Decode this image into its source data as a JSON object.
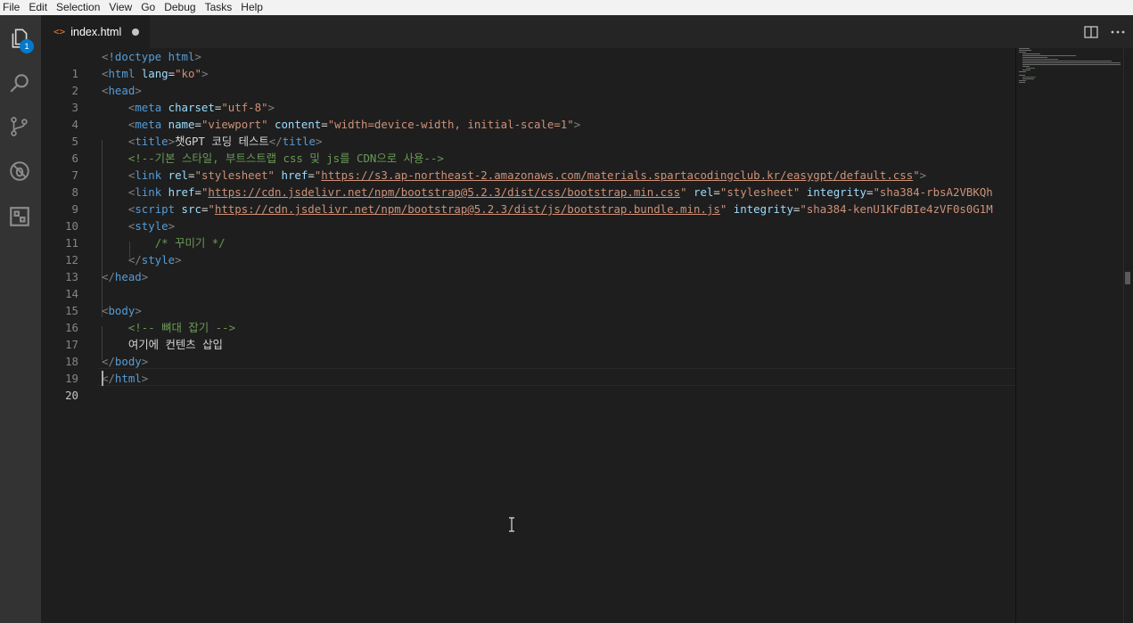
{
  "menu": [
    "File",
    "Edit",
    "Selection",
    "View",
    "Go",
    "Debug",
    "Tasks",
    "Help"
  ],
  "activity": {
    "explorer_badge": "1",
    "icons": [
      "files-icon",
      "search-icon",
      "source-control-icon",
      "debug-icon",
      "extensions-icon"
    ]
  },
  "tab": {
    "icon": "<>",
    "title": "index.html"
  },
  "editor": {
    "active_line": 20,
    "lines": [
      {
        "n": "1"
      },
      {
        "n": "2"
      },
      {
        "n": "3"
      },
      {
        "n": "4"
      },
      {
        "n": "5"
      },
      {
        "n": "6"
      },
      {
        "n": "7"
      },
      {
        "n": "8"
      },
      {
        "n": "9"
      },
      {
        "n": "10"
      },
      {
        "n": "11"
      },
      {
        "n": "12"
      },
      {
        "n": "13"
      },
      {
        "n": "14"
      },
      {
        "n": "15"
      },
      {
        "n": "16"
      },
      {
        "n": "17"
      },
      {
        "n": "18"
      },
      {
        "n": "19"
      },
      {
        "n": "20"
      }
    ],
    "code": {
      "l1_doctype": "!doctype html",
      "l2_attr": "lang",
      "l2_val": "\"ko\"",
      "l4_attr": "charset",
      "l4_val": "\"utf-8\"",
      "l5_attr1": "name",
      "l5_val1": "\"viewport\"",
      "l5_attr2": "content",
      "l5_val2": "\"width=device-width, initial-scale=1\"",
      "l6_title": "챗GPT 코딩 테스트",
      "l7_comment": "<!--기본 스타일, 부트스트랩 css 및 js를 CDN으로 사용-->",
      "l8_attr1": "rel",
      "l8_val1": "\"stylesheet\"",
      "l8_attr2": "href",
      "l8_url": "https://s3.ap-northeast-2.amazonaws.com/materials.spartacodingclub.kr/easygpt/default.css",
      "l9_attr1": "href",
      "l9_url": "https://cdn.jsdelivr.net/npm/bootstrap@5.2.3/dist/css/bootstrap.min.css",
      "l9_attr2": "rel",
      "l9_val2": "\"stylesheet\"",
      "l9_attr3": "integrity",
      "l9_val3": "\"sha384-rbsA2VBKQh",
      "l10_attr1": "src",
      "l10_url": "https://cdn.jsdelivr.net/npm/bootstrap@5.2.3/dist/js/bootstrap.bundle.min.js",
      "l10_attr2": "integrity",
      "l10_val2": "\"sha384-kenU1KFdBIe4zVF0s0G1M",
      "l12_comment": "/* 꾸미기 */",
      "l17_comment": "<!-- 뼈대 잡기 -->",
      "l18_text": "여기에 컨텐츠 삽입"
    },
    "tags": {
      "html": "html",
      "head": "head",
      "meta": "meta",
      "title": "title",
      "link": "link",
      "script": "script",
      "style": "style",
      "body": "body"
    }
  },
  "colors": {
    "keyword_tag": "#569cd6",
    "attribute": "#9cdcfe",
    "string": "#ce9178",
    "comment": "#6a9955",
    "background": "#1e1e1e"
  }
}
